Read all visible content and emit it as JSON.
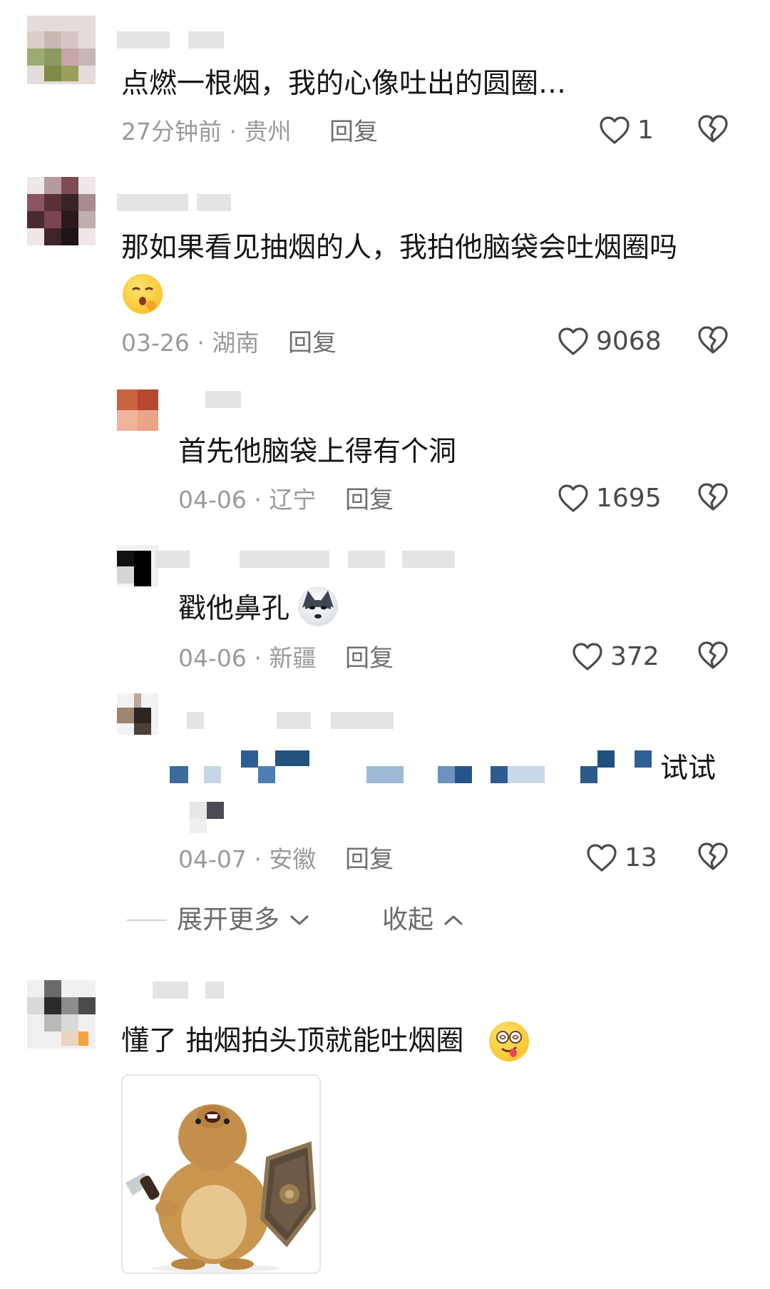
{
  "comments": [
    {
      "text": "点燃一根烟，我的心像吐出的圆圈…",
      "time": "27分钟前",
      "location": "贵州",
      "reply_label": "回复",
      "likes": "1"
    },
    {
      "text": "那如果看见抽烟的人，我拍他脑袋会吐烟圈吗",
      "emoji": "hushed-face-emoji",
      "time": "03-26",
      "location": "湖南",
      "reply_label": "回复",
      "likes": "9068",
      "replies": [
        {
          "text": "首先他脑袋上得有个洞",
          "time": "04-06",
          "location": "辽宁",
          "reply_label": "回复",
          "likes": "1695"
        },
        {
          "text": "戳他鼻孔",
          "emoji": "husky-emoji",
          "time": "04-06",
          "location": "新疆",
          "reply_label": "回复",
          "likes": "372"
        },
        {
          "text_visible_end": "试试",
          "time": "04-07",
          "location": "安徽",
          "reply_label": "回复",
          "likes": "13"
        }
      ]
    },
    {
      "text": "懂了 抽烟拍头顶就能吐烟圈",
      "emoji": "dizzy-face-emoji",
      "sticker": "hamster-with-knife-and-shield-sticker"
    }
  ],
  "thread_controls": {
    "expand_more": "展开更多",
    "collapse": "收起"
  },
  "separator": "·",
  "icons": {
    "like": "heart-outline-icon",
    "dislike": "broken-heart-icon",
    "expand": "chevron-down-icon",
    "collapse": "chevron-up-icon"
  },
  "colors": {
    "text": "#151515",
    "meta": "#9a9a9a",
    "icon": "#4a4a4a"
  }
}
